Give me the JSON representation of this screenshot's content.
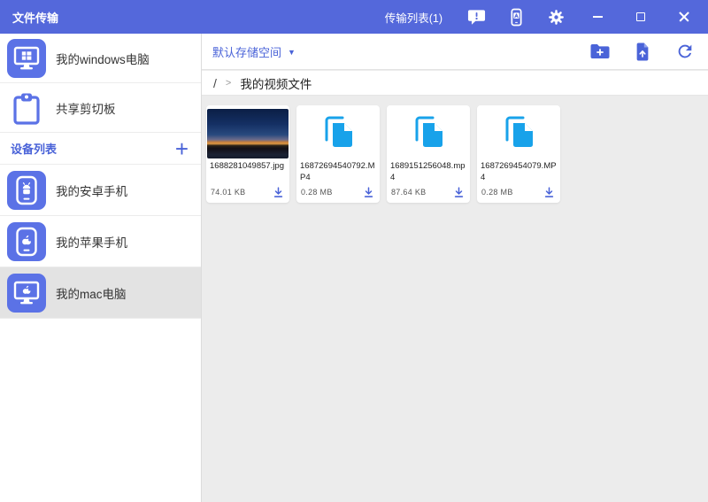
{
  "colors": {
    "titlebar_bg": "#5468db",
    "accent_blue": "#4a63d8",
    "device_icon_indigo": "#5b72e6",
    "file_icon_blue": "#18a2ea",
    "content_bg": "#ececec",
    "selected_item_bg": "#e3e3e3"
  },
  "titlebar": {
    "app_title": "文件传输",
    "transfer_list_label": "传输列表(1)"
  },
  "sidebar": {
    "computer_item": {
      "label": "我的windows电脑",
      "icon": "windows-computer-icon"
    },
    "clipboard_item": {
      "label": "共享剪切板",
      "icon": "clipboard-icon"
    },
    "device_list": {
      "header": "设备列表",
      "add_button": "+",
      "devices": [
        {
          "label": "我的安卓手机",
          "icon": "android-phone-icon",
          "selected": false
        },
        {
          "label": "我的苹果手机",
          "icon": "apple-phone-icon",
          "selected": false
        },
        {
          "label": "我的mac电脑",
          "icon": "mac-computer-icon",
          "selected": true
        }
      ]
    }
  },
  "toolbar": {
    "storage_dropdown_label": "默认存储空间",
    "chevron_down_glyph": "▼",
    "actions": [
      "new-folder-icon",
      "upload-file-icon",
      "refresh-icon"
    ]
  },
  "breadcrumb": {
    "root": "/",
    "separator": ">",
    "current_folder": "我的视频文件"
  },
  "file_grid": {
    "files": [
      {
        "name": "1688281049857.jpg",
        "size": "74.01 KB",
        "kind": "image"
      },
      {
        "name": "16872694540792.MP4",
        "size": "0.28 MB",
        "kind": "video"
      },
      {
        "name": "1689151256048.mp4",
        "size": "87.64 KB",
        "kind": "video"
      },
      {
        "name": "1687269454079.MP4",
        "size": "0.28 MB",
        "kind": "video"
      }
    ]
  }
}
